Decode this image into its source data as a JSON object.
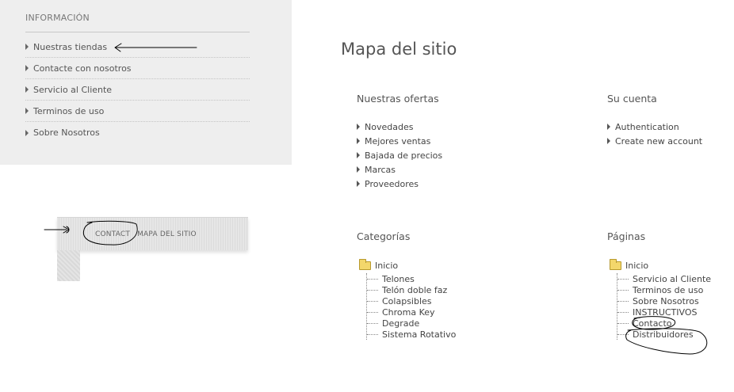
{
  "info": {
    "title": "INFORMACIÓN",
    "items": [
      "Nuestras tiendas",
      "Contacte con nosotros",
      "Servicio al Cliente",
      "Terminos de uso",
      "Sobre Nosotros"
    ]
  },
  "footer": {
    "links": [
      "CONTACT",
      "MAPA DEL SITIO"
    ]
  },
  "sitemap": {
    "title": "Mapa del sitio",
    "offers": {
      "title": "Nuestras ofertas",
      "items": [
        "Novedades",
        "Mejores ventas",
        "Bajada de precios",
        "Marcas",
        "Proveedores"
      ]
    },
    "account": {
      "title": "Su cuenta",
      "items": [
        "Authentication",
        "Create new account"
      ]
    },
    "categories": {
      "title": "Categorías",
      "root": "Inicio",
      "items": [
        "Telones",
        "Telón doble faz",
        "Colapsibles",
        "Chroma Key",
        "Degrade",
        "Sistema Rotativo"
      ]
    },
    "pages": {
      "title": "Páginas",
      "root": "Inicio",
      "items": [
        "Servicio al Cliente",
        "Terminos de uso",
        "Sobre Nosotros",
        "INSTRUCTIVOS",
        "Contacto",
        "Distribuidores"
      ]
    }
  },
  "colors": {
    "panel_bg": "#eeeeee",
    "folder": "#f3d76b",
    "text": "#555555"
  }
}
